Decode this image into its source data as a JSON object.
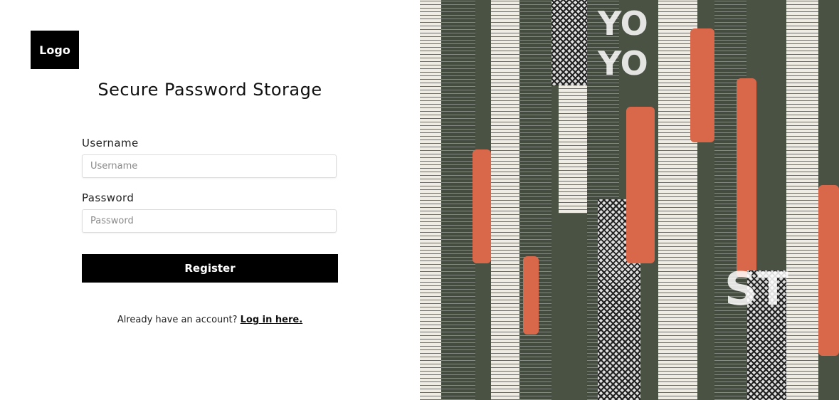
{
  "logo": {
    "text": "Logo"
  },
  "form": {
    "title": "Secure Password Storage",
    "username_label": "Username",
    "username_placeholder": "Username",
    "password_label": "Password",
    "password_placeholder": "Password",
    "register_label": "Register",
    "login_prompt": "Already have an account?",
    "login_link": "Log in here."
  },
  "hero": {
    "description": "collage-artwork"
  },
  "colors": {
    "primary": "#000000",
    "background": "#ffffff",
    "collage_green": "#434c3e",
    "collage_orange": "#d9684a"
  }
}
